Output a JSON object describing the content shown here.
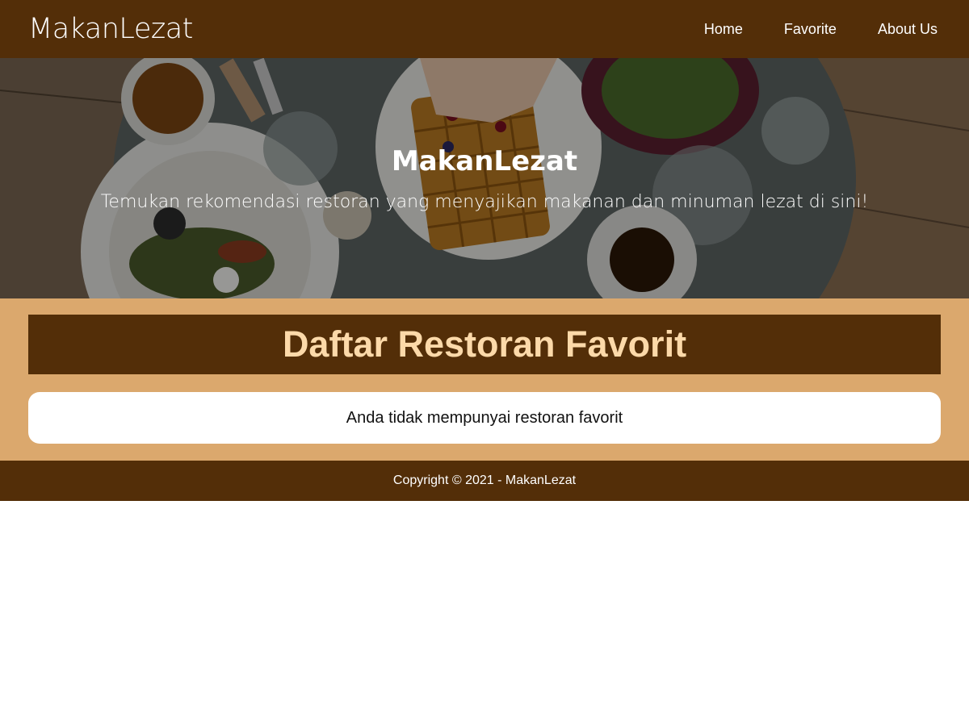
{
  "header": {
    "brand": "MakanLezat",
    "nav": [
      {
        "label": "Home"
      },
      {
        "label": "Favorite"
      },
      {
        "label": "About Us"
      }
    ]
  },
  "hero": {
    "title": "MakanLezat",
    "tagline": "Temukan rekomendasi restoran yang menyajikan makanan dan minuman lezat di sini!"
  },
  "main": {
    "section_title": "Daftar Restoran Favorit",
    "empty_message": "Anda tidak mempunyai restoran favorit"
  },
  "footer": {
    "copyright": "Copyright © 2021 - MakanLezat"
  },
  "colors": {
    "header_bg": "#532e08",
    "main_bg": "#dba86d",
    "section_title_text": "#fcd9a9",
    "card_bg": "#ffffff"
  }
}
